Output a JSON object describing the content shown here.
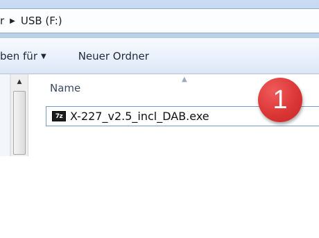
{
  "address_bar": {
    "previous_crumb": "r",
    "separator": "▶",
    "current_location": "USB (F:)"
  },
  "toolbar": {
    "share_label": "ben für",
    "share_caret": "▼",
    "new_folder_label": "Neuer Ordner"
  },
  "file_list": {
    "column_header": "Name",
    "sort_indicator": "▲",
    "files": [
      {
        "icon": "7z",
        "name": "X-227_v2.5_incl_DAB.exe"
      }
    ]
  },
  "scrollbar": {
    "up_arrow": "▲"
  },
  "annotation": {
    "number": "1",
    "color": "#d93434"
  }
}
